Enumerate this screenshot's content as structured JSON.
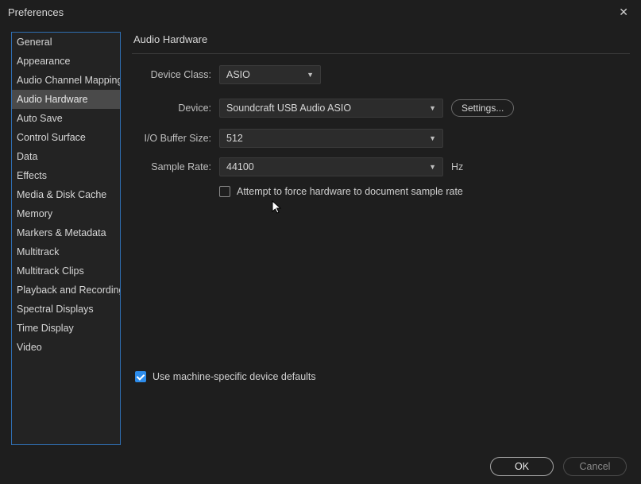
{
  "window": {
    "title": "Preferences"
  },
  "sidebar": {
    "items": [
      {
        "label": "General"
      },
      {
        "label": "Appearance"
      },
      {
        "label": "Audio Channel Mapping"
      },
      {
        "label": "Audio Hardware"
      },
      {
        "label": "Auto Save"
      },
      {
        "label": "Control Surface"
      },
      {
        "label": "Data"
      },
      {
        "label": "Effects"
      },
      {
        "label": "Media & Disk Cache"
      },
      {
        "label": "Memory"
      },
      {
        "label": "Markers & Metadata"
      },
      {
        "label": "Multitrack"
      },
      {
        "label": "Multitrack Clips"
      },
      {
        "label": "Playback and Recording"
      },
      {
        "label": "Spectral Displays"
      },
      {
        "label": "Time Display"
      },
      {
        "label": "Video"
      }
    ],
    "selected_index": 3
  },
  "main": {
    "section_title": "Audio Hardware",
    "device_class": {
      "label": "Device Class:",
      "value": "ASIO"
    },
    "device": {
      "label": "Device:",
      "value": "Soundcraft USB Audio ASIO",
      "settings_label": "Settings..."
    },
    "io_buffer": {
      "label": "I/O Buffer Size:",
      "value": "512"
    },
    "sample_rate": {
      "label": "Sample Rate:",
      "value": "44100",
      "unit": "Hz"
    },
    "force_hw": {
      "label": "Attempt to force hardware to document sample rate",
      "checked": false
    },
    "machine_defaults": {
      "label": "Use machine-specific device defaults",
      "checked": true
    }
  },
  "footer": {
    "ok": "OK",
    "cancel": "Cancel"
  }
}
